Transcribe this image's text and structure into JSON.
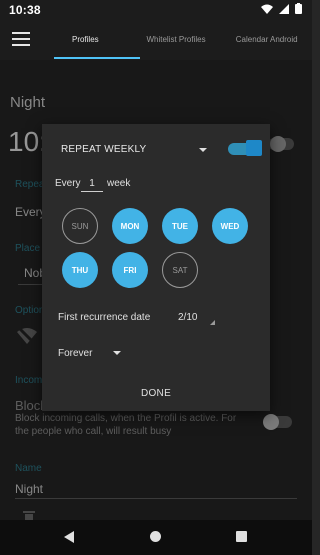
{
  "status_bar": {
    "time": "10:38"
  },
  "app_bar": {
    "tabs": [
      {
        "label": "Profiles"
      },
      {
        "label": "Whitelist Profiles"
      },
      {
        "label": "Calendar Android"
      }
    ]
  },
  "background": {
    "profile_name": "Night",
    "time_partial": "10:",
    "repeat_label": "Repeat",
    "every_partial": "Every",
    "place_label": "Place",
    "place_value_partial": "Nob",
    "options_label": "Option",
    "incoming_label": "Incom",
    "block_title_partial": "Block",
    "block_desc": "Block incoming calls, when the Profil is active. For the people who call, will result busy",
    "name_label": "Name",
    "name_value": "Night"
  },
  "dialog": {
    "title": "REPEAT WEEKLY",
    "every_label": "Every",
    "interval_value": "1",
    "unit_label": "week",
    "days": [
      {
        "label": "SUN",
        "selected": false
      },
      {
        "label": "MON",
        "selected": true
      },
      {
        "label": "TUE",
        "selected": true
      },
      {
        "label": "WED",
        "selected": true
      },
      {
        "label": "THU",
        "selected": true
      },
      {
        "label": "FRI",
        "selected": true
      },
      {
        "label": "SAT",
        "selected": false
      }
    ],
    "first_recurrence_label": "First recurrence date",
    "first_recurrence_value": "2/10",
    "end_option": "Forever",
    "done_label": "DONE"
  },
  "colors": {
    "accent": "#42b3e6",
    "switch_on": "#1e88c8"
  }
}
